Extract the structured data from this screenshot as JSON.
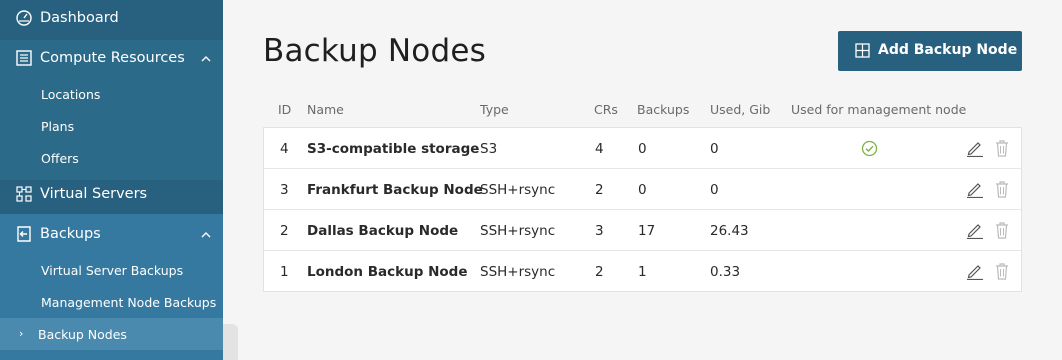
{
  "sidebar": {
    "items": [
      {
        "label": "Dashboard",
        "icon": "dashboard-icon"
      },
      {
        "label": "Compute Resources",
        "icon": "server-list-icon",
        "expanded": true,
        "children": [
          {
            "label": "Locations"
          },
          {
            "label": "Plans"
          },
          {
            "label": "Offers"
          }
        ]
      },
      {
        "label": "Virtual Servers",
        "icon": "virtual-servers-icon"
      },
      {
        "label": "Backups",
        "icon": "backup-icon",
        "expanded": true,
        "children": [
          {
            "label": "Virtual Server Backups"
          },
          {
            "label": "Management Node Backups"
          },
          {
            "label": "Backup Nodes",
            "active": true
          }
        ]
      }
    ]
  },
  "main": {
    "title": "Backup Nodes",
    "add_button": {
      "label": "Add Backup Node",
      "icon": "grid-plus-icon"
    },
    "table": {
      "headers": {
        "id": "ID",
        "name": "Name",
        "type": "Type",
        "crs": "CRs",
        "backups": "Backups",
        "used": "Used, Gib",
        "mgmt": "Used for management node"
      },
      "rows": [
        {
          "id": "4",
          "name": "S3-compatible storage",
          "type": "S3",
          "crs": "4",
          "backups": "0",
          "used": "0",
          "mgmt": true
        },
        {
          "id": "3",
          "name": "Frankfurt Backup Node",
          "type": "SSH+rsync",
          "crs": "2",
          "backups": "0",
          "used": "0",
          "mgmt": false
        },
        {
          "id": "2",
          "name": "Dallas Backup Node",
          "type": "SSH+rsync",
          "crs": "3",
          "backups": "17",
          "used": "26.43",
          "mgmt": false
        },
        {
          "id": "1",
          "name": "London Backup Node",
          "type": "SSH+rsync",
          "crs": "2",
          "backups": "1",
          "used": "0.33",
          "mgmt": false
        }
      ]
    }
  },
  "colors": {
    "sidebar": "#28607f",
    "accent": "#28607f",
    "check_green": "#7cb342"
  }
}
